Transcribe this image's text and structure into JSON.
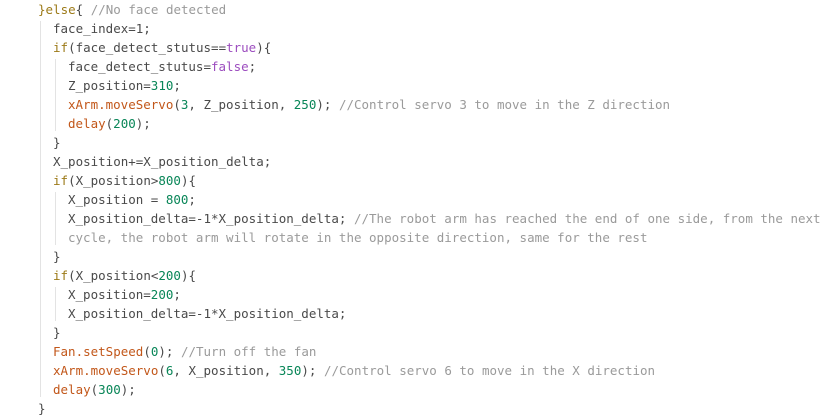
{
  "code": {
    "lines": [
      {
        "indent": 0,
        "tokens": [
          [
            "kw",
            "}else"
          ],
          [
            "plain",
            "{ "
          ],
          [
            "cmt",
            "//No face detected"
          ]
        ]
      },
      {
        "indent": 1,
        "tokens": [
          [
            "plain",
            "face_index=1;"
          ]
        ]
      },
      {
        "indent": 1,
        "tokens": [
          [
            "kw",
            "if"
          ],
          [
            "plain",
            "(face_detect_stutus=="
          ],
          [
            "bool",
            "true"
          ],
          [
            "plain",
            "){"
          ]
        ]
      },
      {
        "indent": 2,
        "tokens": [
          [
            "plain",
            "face_detect_stutus="
          ],
          [
            "bool",
            "false"
          ],
          [
            "plain",
            ";"
          ]
        ]
      },
      {
        "indent": 2,
        "tokens": [
          [
            "plain",
            "Z_position="
          ],
          [
            "num",
            "310"
          ],
          [
            "plain",
            ";"
          ]
        ]
      },
      {
        "indent": 2,
        "tokens": [
          [
            "fn",
            "xArm.moveServo"
          ],
          [
            "plain",
            "("
          ],
          [
            "num",
            "3"
          ],
          [
            "plain",
            ", Z_position, "
          ],
          [
            "num",
            "250"
          ],
          [
            "plain",
            "); "
          ],
          [
            "cmt",
            "//Control servo 3 to move in the Z direction"
          ]
        ]
      },
      {
        "indent": 2,
        "tokens": [
          [
            "fn",
            "delay"
          ],
          [
            "plain",
            "("
          ],
          [
            "num",
            "200"
          ],
          [
            "plain",
            ");"
          ]
        ]
      },
      {
        "indent": 1,
        "tokens": [
          [
            "plain",
            "}"
          ]
        ]
      },
      {
        "indent": 1,
        "tokens": [
          [
            "plain",
            "X_position+=X_position_delta;"
          ]
        ]
      },
      {
        "indent": 1,
        "tokens": [
          [
            "kw",
            "if"
          ],
          [
            "plain",
            "(X_position>"
          ],
          [
            "num",
            "800"
          ],
          [
            "plain",
            "){"
          ]
        ]
      },
      {
        "indent": 2,
        "tokens": [
          [
            "plain",
            "X_position = "
          ],
          [
            "num",
            "800"
          ],
          [
            "plain",
            ";"
          ]
        ]
      },
      {
        "indent": 2,
        "tokens": [
          [
            "plain",
            "X_position_delta=-1*X_position_delta; "
          ],
          [
            "cmt",
            "//The robot arm has reached the end of one side, from the next"
          ]
        ]
      },
      {
        "indent": 2,
        "tokens": [
          [
            "cmt",
            "cycle, the robot arm will rotate in the opposite direction, same for the rest"
          ]
        ]
      },
      {
        "indent": 1,
        "tokens": [
          [
            "plain",
            "}"
          ]
        ]
      },
      {
        "indent": 1,
        "tokens": [
          [
            "kw",
            "if"
          ],
          [
            "plain",
            "(X_position<"
          ],
          [
            "num",
            "200"
          ],
          [
            "plain",
            "){"
          ]
        ]
      },
      {
        "indent": 2,
        "tokens": [
          [
            "plain",
            "X_position="
          ],
          [
            "num",
            "200"
          ],
          [
            "plain",
            ";"
          ]
        ]
      },
      {
        "indent": 2,
        "tokens": [
          [
            "plain",
            "X_position_delta=-1*X_position_delta;"
          ]
        ]
      },
      {
        "indent": 1,
        "tokens": [
          [
            "plain",
            "}"
          ]
        ]
      },
      {
        "indent": 1,
        "tokens": [
          [
            "fn",
            "Fan.setSpeed"
          ],
          [
            "plain",
            "("
          ],
          [
            "num",
            "0"
          ],
          [
            "plain",
            "); "
          ],
          [
            "cmt",
            "//Turn off the fan"
          ]
        ]
      },
      {
        "indent": 1,
        "tokens": [
          [
            "fn",
            "xArm.moveServo"
          ],
          [
            "plain",
            "("
          ],
          [
            "num",
            "6"
          ],
          [
            "plain",
            ", X_position, "
          ],
          [
            "num",
            "350"
          ],
          [
            "plain",
            "); "
          ],
          [
            "cmt",
            "//Control servo 6 to move in the X direction"
          ]
        ]
      },
      {
        "indent": 1,
        "tokens": [
          [
            "fn",
            "delay"
          ],
          [
            "plain",
            "("
          ],
          [
            "num",
            "300"
          ],
          [
            "plain",
            ");"
          ]
        ]
      },
      {
        "indent": 0,
        "tokens": [
          [
            "plain",
            "}"
          ]
        ]
      }
    ]
  },
  "colors": {
    "keyword": "#9c7a18",
    "function": "#c2571a",
    "number": "#098658",
    "boolean": "#9c4dbf",
    "comment": "#9a9a9a",
    "text": "#4a4a4a",
    "indent_guide": "#e3e3e3",
    "background": "#ffffff"
  }
}
